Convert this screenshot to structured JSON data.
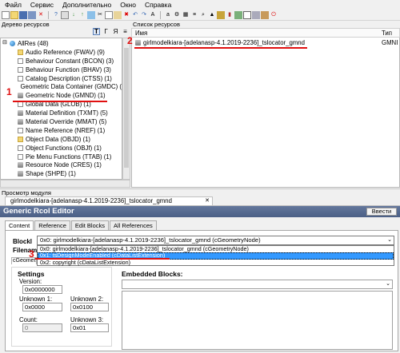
{
  "menu": [
    "Файл",
    "Сервис",
    "Дополнительно",
    "Окно",
    "Справка"
  ],
  "toolbar_icons": [
    "new-file-icon",
    "open-folder-icon",
    "save-icon",
    "save-all-icon",
    "close-icon",
    "help-icon",
    "properties-icon",
    "import-icon",
    "export-icon",
    "image-icon",
    "cut-icon",
    "copy-icon",
    "paste-icon",
    "delete-icon",
    "undo-icon",
    "redo-icon",
    "text-icon",
    "font-icon",
    "settings-icon",
    "grid-icon",
    "list-icon",
    "search-icon",
    "arrow-up-icon",
    "lock-icon",
    "chart-icon",
    "plugin-icon",
    "window-icon",
    "toggle-icon",
    "package-icon",
    "exit-icon"
  ],
  "tree": {
    "header": "Дерево ресурсов",
    "view_buttons": [
      "T",
      "Г",
      "Я",
      "≡"
    ],
    "root": "AllRes (48)",
    "items": [
      {
        "label": "Audio Reference (FWAV) (9)",
        "icon": "folder"
      },
      {
        "label": "Behaviour Constant (BCON) (3)",
        "icon": "page"
      },
      {
        "label": "Behaviour Function (BHAV) (3)",
        "icon": "page"
      },
      {
        "label": "Catalog Description (CTSS) (1)",
        "icon": "page"
      },
      {
        "label": "Geometric Data Container (GMDC) (",
        "icon": "cyl"
      },
      {
        "label": "Geometric Node (GMND) (1)",
        "icon": "cyl"
      },
      {
        "label": "Global Data (GLOB) (1)",
        "icon": "page"
      },
      {
        "label": "Material Definition (TXMT) (5)",
        "icon": "cyl"
      },
      {
        "label": "Material Override (MMAT) (5)",
        "icon": "cyl"
      },
      {
        "label": "Name Reference (NREF) (1)",
        "icon": "page"
      },
      {
        "label": "Object Data (OBJD) (1)",
        "icon": "folder"
      },
      {
        "label": "Object Functions (OBJf) (1)",
        "icon": "page"
      },
      {
        "label": "Pie Menu Functions (TTAB) (1)",
        "icon": "page"
      },
      {
        "label": "Resource Node (CRES) (1)",
        "icon": "cyl"
      },
      {
        "label": "Shape (SHPE) (1)",
        "icon": "cyl"
      }
    ]
  },
  "list": {
    "header": "Список ресурсов",
    "col_name": "Имя",
    "col_type": "Тип",
    "rows": [
      {
        "name": "girlmodelkiara-[adelanasp-4.1.2019-2236]_tslocator_gmnd",
        "type": "GMNI"
      }
    ]
  },
  "preview": {
    "header": "Просмотр модуля",
    "doc_tab": "girlmodelkiara-[adelanasp-4.1.2019-2236]_tslocator_gmnd"
  },
  "editor": {
    "title": "Generic Rcol Editor",
    "commit": "Ввести",
    "tabs": [
      "Content",
      "Reference",
      "Edit Blocks",
      "All References"
    ],
    "blocklist_label": "Blockl",
    "filename_label": "Filenam",
    "blocklist_value": "0x0: girlmodelkiara-[adelanasp-4.1.2019-2236]_tslocator_gmnd (cGeometryNode)",
    "dropdown_options": [
      "0x0: girlmodelkiara-[adelanasp-4.1.2019-2236]_tslocator_gmnd (cGeometryNode)",
      "0x1: tsDesignModeEnabled (cDataListExtension)",
      "0x2: copyright (cDataListExtension)"
    ],
    "selected_option": 1,
    "subtab": "cGeomet",
    "settings": {
      "title": "Settings",
      "version_label": "Version:",
      "version_value": "0x0000000",
      "unknown1_label": "Unknown 1:",
      "unknown1_value": "0x0000",
      "unknown2_label": "Unknown 2:",
      "unknown2_value": "0x0100",
      "count_label": "Count:",
      "count_value": "0",
      "unknown3_label": "Unknown 3:",
      "unknown3_value": "0x01"
    },
    "embedded_title": "Embedded Blocks:"
  },
  "annotations": {
    "marker1": "1",
    "marker2": "2",
    "marker3": "3",
    "color": "#e01010"
  }
}
